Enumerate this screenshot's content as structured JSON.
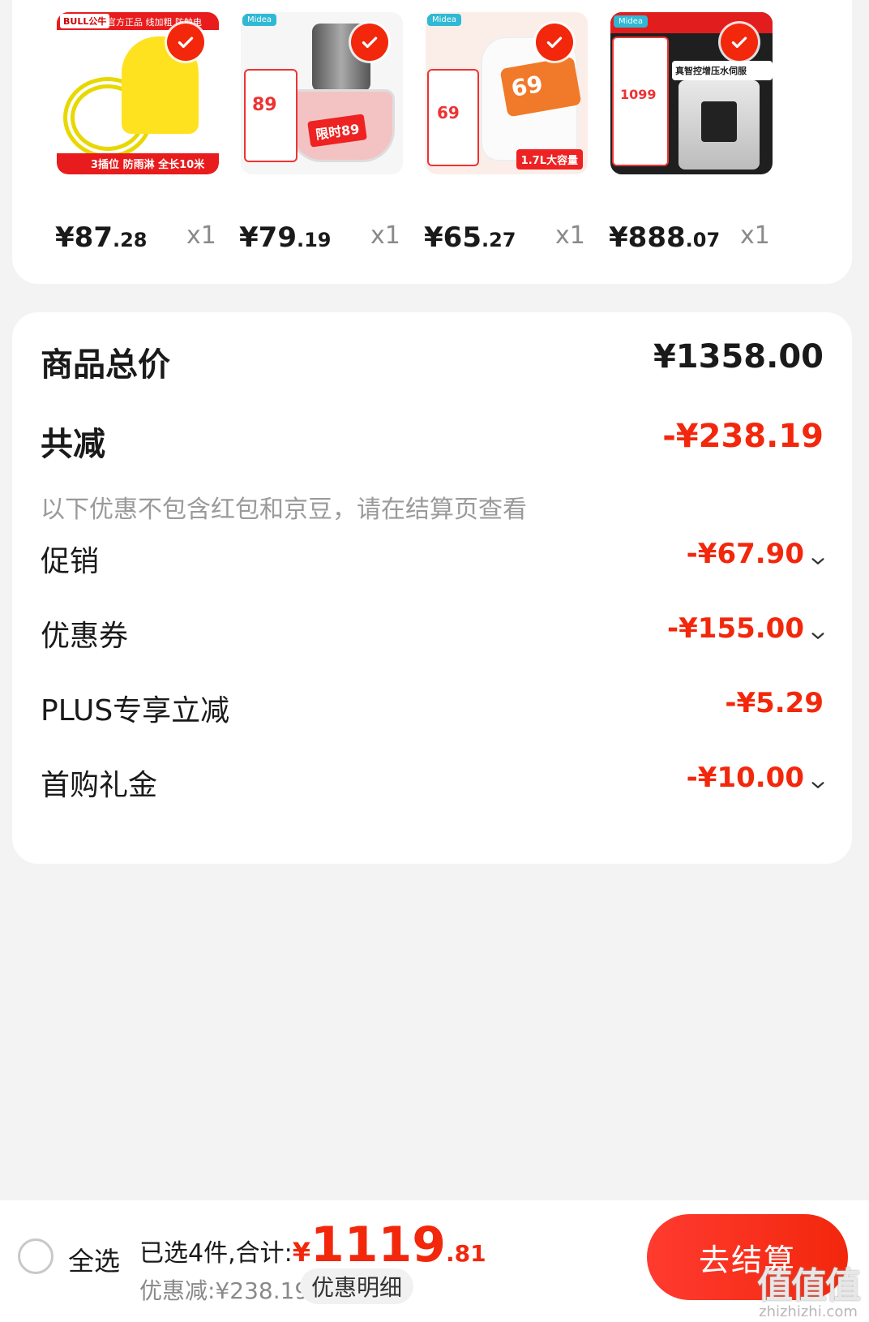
{
  "products": [
    {
      "name": "bull-extension-cord",
      "price_int": "¥87",
      "price_dec": ".28",
      "qty": "x1",
      "art": {
        "brand": "BULL公牛",
        "top": "官方正品 线加粗 防触电",
        "bottom": "3插位 防雨淋 全长10米"
      }
    },
    {
      "name": "midea-meat-chopper",
      "price_int": "¥79",
      "price_dec": ".19",
      "qty": "x1",
      "art": {
        "badge": "Midea",
        "tag": "89",
        "banner": "限时89"
      }
    },
    {
      "name": "midea-electric-kettle",
      "price_int": "¥65",
      "price_dec": ".27",
      "qty": "x1",
      "art": {
        "badge": "Midea",
        "tag": "69",
        "bolt": "69",
        "cap": "1.7L大容量"
      }
    },
    {
      "name": "midea-water-heater",
      "price_int": "¥888",
      "price_dec": ".07",
      "qty": "x1",
      "art": {
        "badge": "Midea",
        "tag": "1099",
        "stripe": "真智控增压水伺服"
      }
    }
  ],
  "summary": {
    "total_label": "商品总价",
    "total_value": "¥1358.00",
    "discount_label": "共减",
    "discount_value": "-¥238.19",
    "note": "以下优惠不包含红包和京豆，请在结算页查看",
    "items": [
      {
        "label": "促销",
        "value": "-¥67.90",
        "expandable": true
      },
      {
        "label": "优惠券",
        "value": "-¥155.00",
        "expandable": true
      },
      {
        "label": "PLUS专享立减",
        "value": "-¥5.29",
        "expandable": false
      },
      {
        "label": "首购礼金",
        "value": "-¥10.00",
        "expandable": true
      }
    ]
  },
  "bottom_bar": {
    "select_all": "全选",
    "selected_text": "已选4件,合计:",
    "currency": "¥",
    "total_int": "1119",
    "total_dec": ".81",
    "discount_text": "优惠减:¥238.19",
    "detail_button": "优惠明细",
    "checkout_button": "去结算"
  },
  "watermark": {
    "logo": "值值值",
    "url": "zhizhizhi.com"
  },
  "colors": {
    "accent": "#f2270c",
    "background": "#f3f3f3",
    "card": "#ffffff"
  }
}
